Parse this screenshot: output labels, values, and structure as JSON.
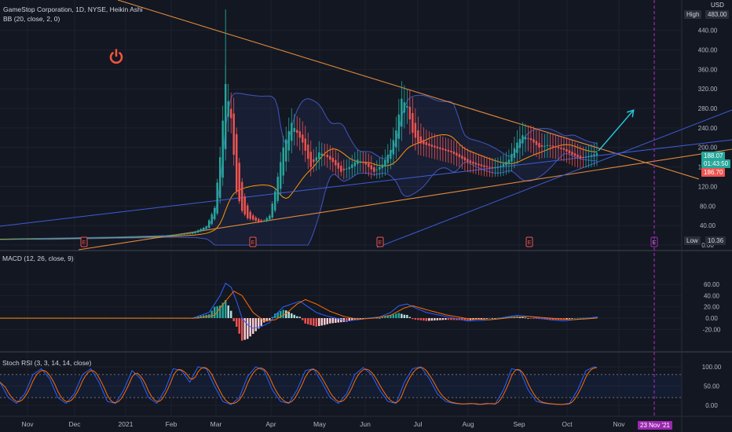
{
  "header": {
    "symbol": "GameStop Corporation, 1D, NYSE, Heikin Ashi",
    "overlay": "BB (20, close, 2, 0)",
    "currency": "USD"
  },
  "panels": {
    "macd_title": "MACD (12, 26, close, 9)",
    "rsi_title": "Stoch RSI (3, 3, 14, 14, close)"
  },
  "badges": {
    "high_label": "High",
    "high_value": "483.00",
    "low_label": "Low",
    "low_value": "10.36",
    "last_price": "188.07",
    "countdown": "01:43:50",
    "bb_basis": "186.70",
    "date_marker": "23 Nov '21"
  },
  "colors": {
    "background": "#131722",
    "up": "#26a69a",
    "down": "#ef5350",
    "bb_band": "#3f51b5",
    "bb_basis": "#ff9800",
    "trend_orange": "#e08a3c",
    "trend_blue": "#3d5dd6",
    "macd_line": "#2962ff",
    "signal_line": "#ff6d00",
    "stoch_k": "#2962ff",
    "stoch_d": "#ff6d00",
    "forecast_arrow": "#26c6da",
    "marker_line": "#9c27b0",
    "power_icon": "#f0553d"
  },
  "icons": {
    "power": "power-icon",
    "earnings": "earnings-icon",
    "dividend": "dividend-icon"
  },
  "chart_data": [
    {
      "type": "candlestick",
      "style": "heikin-ashi",
      "x_ticks": [
        "Nov",
        "Dec",
        "2021",
        "Feb",
        "Mar",
        "Apr",
        "May",
        "Jun",
        "Jul",
        "Aug",
        "Sep",
        "Oct",
        "Nov"
      ],
      "y_ticks": [
        "440.00",
        "400.00",
        "360.00",
        "320.00",
        "280.00",
        "240.00",
        "200.00",
        "160.00",
        "120.00",
        "80.00",
        "40.00",
        "0.00"
      ],
      "ylim": [
        0,
        483
      ],
      "series_closes": [
        [
          0,
          12
        ],
        [
          20,
          14
        ],
        [
          40,
          16
        ],
        [
          60,
          19
        ],
        [
          70,
          25
        ],
        [
          75,
          38
        ],
        [
          78,
          76
        ],
        [
          80,
          180
        ],
        [
          82,
          330
        ],
        [
          84,
          260
        ],
        [
          86,
          110
        ],
        [
          88,
          70
        ],
        [
          90,
          55
        ],
        [
          92,
          52
        ],
        [
          94,
          48
        ],
        [
          96,
          50
        ],
        [
          98,
          60
        ],
        [
          100,
          110
        ],
        [
          103,
          200
        ],
        [
          106,
          250
        ],
        [
          108,
          230
        ],
        [
          110,
          210
        ],
        [
          113,
          160
        ],
        [
          116,
          190
        ],
        [
          118,
          185
        ],
        [
          121,
          170
        ],
        [
          124,
          150
        ],
        [
          127,
          160
        ],
        [
          130,
          175
        ],
        [
          133,
          165
        ],
        [
          136,
          150
        ],
        [
          139,
          165
        ],
        [
          142,
          195
        ],
        [
          144,
          235
        ],
        [
          146,
          300
        ],
        [
          148,
          285
        ],
        [
          150,
          230
        ],
        [
          152,
          210
        ],
        [
          155,
          205
        ],
        [
          158,
          200
        ],
        [
          161,
          195
        ],
        [
          164,
          190
        ],
        [
          167,
          180
        ],
        [
          170,
          170
        ],
        [
          173,
          165
        ],
        [
          176,
          160
        ],
        [
          179,
          158
        ],
        [
          182,
          162
        ],
        [
          185,
          175
        ],
        [
          188,
          210
        ],
        [
          190,
          225
        ],
        [
          193,
          215
        ],
        [
          196,
          200
        ],
        [
          199,
          205
        ],
        [
          202,
          200
        ],
        [
          205,
          195
        ],
        [
          208,
          185
        ],
        [
          211,
          178
        ],
        [
          214,
          182
        ],
        [
          217,
          188
        ]
      ],
      "markers": [
        "E",
        "E",
        "E",
        "E",
        "E"
      ]
    },
    {
      "type": "bar+line",
      "name": "MACD (12, 26, close, 9)",
      "y_ticks": [
        "60.00",
        "40.00",
        "20.00",
        "0.00",
        "-20.00"
      ],
      "ylim": [
        -25,
        70
      ],
      "series": [
        {
          "role": "macd",
          "points": [
            [
              0,
              0
            ],
            [
              70,
              0
            ],
            [
              76,
              10
            ],
            [
              80,
              40
            ],
            [
              82,
              62
            ],
            [
              84,
              55
            ],
            [
              86,
              30
            ],
            [
              88,
              0
            ],
            [
              90,
              -12
            ],
            [
              92,
              -18
            ],
            [
              95,
              -15
            ],
            [
              98,
              -8
            ],
            [
              100,
              5
            ],
            [
              103,
              20
            ],
            [
              106,
              25
            ],
            [
              109,
              30
            ],
            [
              112,
              20
            ],
            [
              115,
              10
            ],
            [
              118,
              5
            ],
            [
              122,
              0
            ],
            [
              126,
              -5
            ],
            [
              130,
              -3
            ],
            [
              134,
              0
            ],
            [
              138,
              2
            ],
            [
              142,
              10
            ],
            [
              145,
              22
            ],
            [
              148,
              25
            ],
            [
              151,
              18
            ],
            [
              155,
              10
            ],
            [
              160,
              5
            ],
            [
              165,
              0
            ],
            [
              170,
              -5
            ],
            [
              175,
              -4
            ],
            [
              180,
              -2
            ],
            [
              184,
              2
            ],
            [
              188,
              5
            ],
            [
              192,
              3
            ],
            [
              196,
              0
            ],
            [
              200,
              -3
            ],
            [
              205,
              -5
            ],
            [
              210,
              -2
            ],
            [
              214,
              0
            ],
            [
              217,
              2
            ]
          ]
        },
        {
          "role": "signal",
          "points": [
            [
              0,
              0
            ],
            [
              72,
              0
            ],
            [
              78,
              5
            ],
            [
              82,
              30
            ],
            [
              85,
              48
            ],
            [
              88,
              40
            ],
            [
              92,
              10
            ],
            [
              96,
              -5
            ],
            [
              100,
              -3
            ],
            [
              104,
              8
            ],
            [
              108,
              25
            ],
            [
              111,
              33
            ],
            [
              115,
              25
            ],
            [
              120,
              12
            ],
            [
              125,
              3
            ],
            [
              130,
              -2
            ],
            [
              136,
              0
            ],
            [
              142,
              5
            ],
            [
              147,
              18
            ],
            [
              150,
              22
            ],
            [
              155,
              15
            ],
            [
              162,
              6
            ],
            [
              170,
              -1
            ],
            [
              178,
              -3
            ],
            [
              186,
              1
            ],
            [
              192,
              3
            ],
            [
              200,
              0
            ],
            [
              208,
              -3
            ],
            [
              214,
              -1
            ],
            [
              217,
              0
            ]
          ]
        }
      ]
    },
    {
      "type": "line",
      "name": "Stoch RSI (3, 3, 14, 14, close)",
      "y_ticks": [
        "100.00",
        "50.00",
        "0.00"
      ],
      "ylim": [
        -10,
        110
      ],
      "series": [
        {
          "role": "k",
          "points": [
            [
              0,
              60
            ],
            [
              3,
              20
            ],
            [
              6,
              5
            ],
            [
              9,
              30
            ],
            [
              12,
              80
            ],
            [
              15,
              95
            ],
            [
              18,
              70
            ],
            [
              21,
              20
            ],
            [
              24,
              5
            ],
            [
              27,
              30
            ],
            [
              30,
              80
            ],
            [
              33,
              95
            ],
            [
              36,
              60
            ],
            [
              39,
              10
            ],
            [
              42,
              5
            ],
            [
              45,
              40
            ],
            [
              48,
              90
            ],
            [
              51,
              70
            ],
            [
              54,
              20
            ],
            [
              57,
              5
            ],
            [
              60,
              40
            ],
            [
              63,
              95
            ],
            [
              66,
              90
            ],
            [
              69,
              60
            ],
            [
              72,
              100
            ],
            [
              75,
              95
            ],
            [
              78,
              50
            ],
            [
              81,
              10
            ],
            [
              84,
              2
            ],
            [
              87,
              20
            ],
            [
              90,
              75
            ],
            [
              93,
              100
            ],
            [
              96,
              90
            ],
            [
              99,
              40
            ],
            [
              102,
              10
            ],
            [
              105,
              5
            ],
            [
              108,
              40
            ],
            [
              111,
              90
            ],
            [
              114,
              95
            ],
            [
              117,
              60
            ],
            [
              120,
              20
            ],
            [
              123,
              5
            ],
            [
              126,
              30
            ],
            [
              129,
              80
            ],
            [
              132,
              98
            ],
            [
              135,
              80
            ],
            [
              138,
              40
            ],
            [
              141,
              10
            ],
            [
              144,
              5
            ],
            [
              147,
              60
            ],
            [
              150,
              95
            ],
            [
              153,
              100
            ],
            [
              156,
              70
            ],
            [
              159,
              30
            ],
            [
              162,
              10
            ],
            [
              165,
              5
            ],
            [
              168,
              3
            ],
            [
              171,
              5
            ],
            [
              174,
              2
            ],
            [
              177,
              5
            ],
            [
              180,
              3
            ],
            [
              183,
              40
            ],
            [
              186,
              95
            ],
            [
              189,
              90
            ],
            [
              192,
              40
            ],
            [
              195,
              10
            ],
            [
              198,
              5
            ],
            [
              201,
              3
            ],
            [
              204,
              2
            ],
            [
              207,
              5
            ],
            [
              210,
              40
            ],
            [
              213,
              90
            ],
            [
              216,
              100
            ],
            [
              217,
              98
            ]
          ]
        }
      ]
    }
  ]
}
